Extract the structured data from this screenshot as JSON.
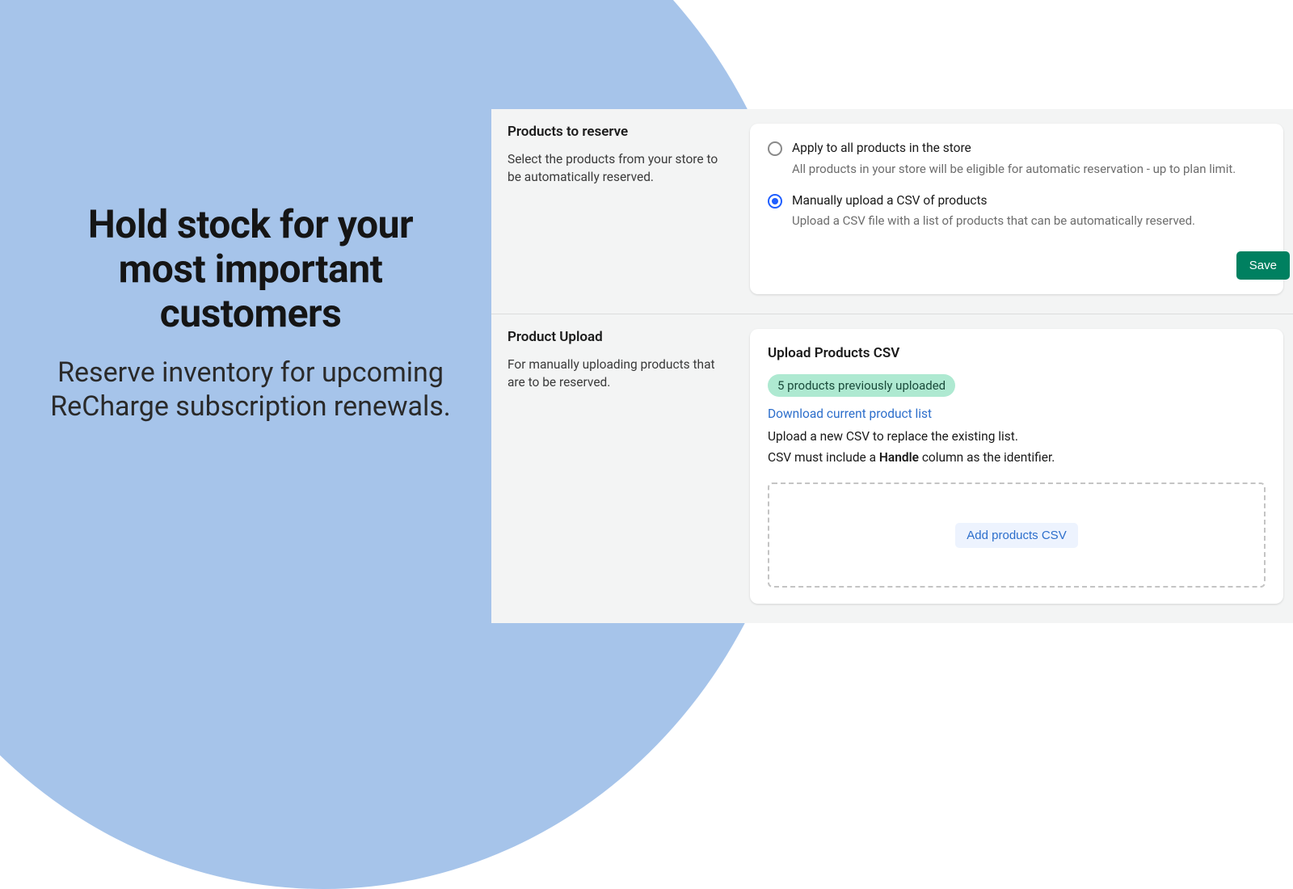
{
  "hero": {
    "title": "Hold stock for your most important customers",
    "subtitle": "Reserve inventory for upcoming ReCharge subscription renewals."
  },
  "sections": {
    "reserve": {
      "title": "Products to reserve",
      "description": "Select the products from your store to be automatically reserved.",
      "option_all": {
        "label": "Apply to all products in the store",
        "sub": "All products in your store will be eligible for automatic reservation - up to plan limit."
      },
      "option_csv": {
        "label": "Manually upload a CSV of products",
        "sub": "Upload a CSV file with a list of products that can be automatically reserved."
      },
      "save_label": "Save"
    },
    "upload": {
      "title": "Product Upload",
      "description": "For manually uploading products that are to be reserved.",
      "card_title": "Upload Products CSV",
      "badge": "5 products previously uploaded",
      "download_link": "Download current product list",
      "replace_text": "Upload a new CSV to replace the existing list.",
      "csv_note_prefix": "CSV must include a ",
      "csv_note_bold": "Handle",
      "csv_note_suffix": " column as the identifier.",
      "dropzone_button": "Add products CSV"
    }
  }
}
